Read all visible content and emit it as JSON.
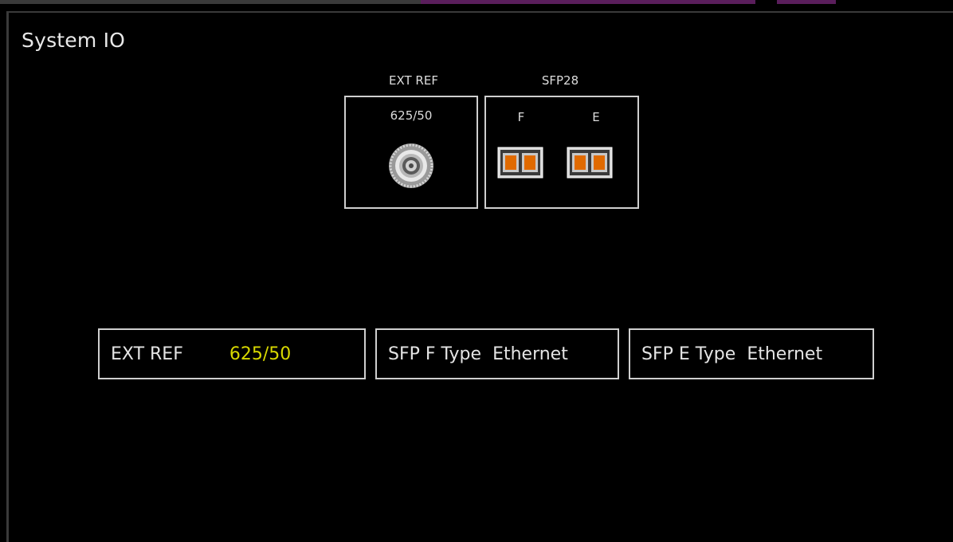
{
  "panel": {
    "title": "System IO"
  },
  "connectors": {
    "ext_ref_header": "EXT REF",
    "sfp28_header": "SFP28",
    "ext_ref_value": "625/50",
    "sfp_f_label": "F",
    "sfp_e_label": "E"
  },
  "status": {
    "ext_ref_label": "EXT REF",
    "ext_ref_value": "625/50",
    "sfp_f_label": "SFP F Type",
    "sfp_f_value": "Ethernet",
    "sfp_e_label": "SFP E Type",
    "sfp_e_value": "Ethernet"
  },
  "colors": {
    "background": "#000000",
    "border": "#cfcfcf",
    "value_highlight": "#d8d800",
    "sfp_port": "#e06a00"
  },
  "icons": {
    "bnc": "bnc-connector-icon",
    "sfp": "sfp-port-icon"
  }
}
